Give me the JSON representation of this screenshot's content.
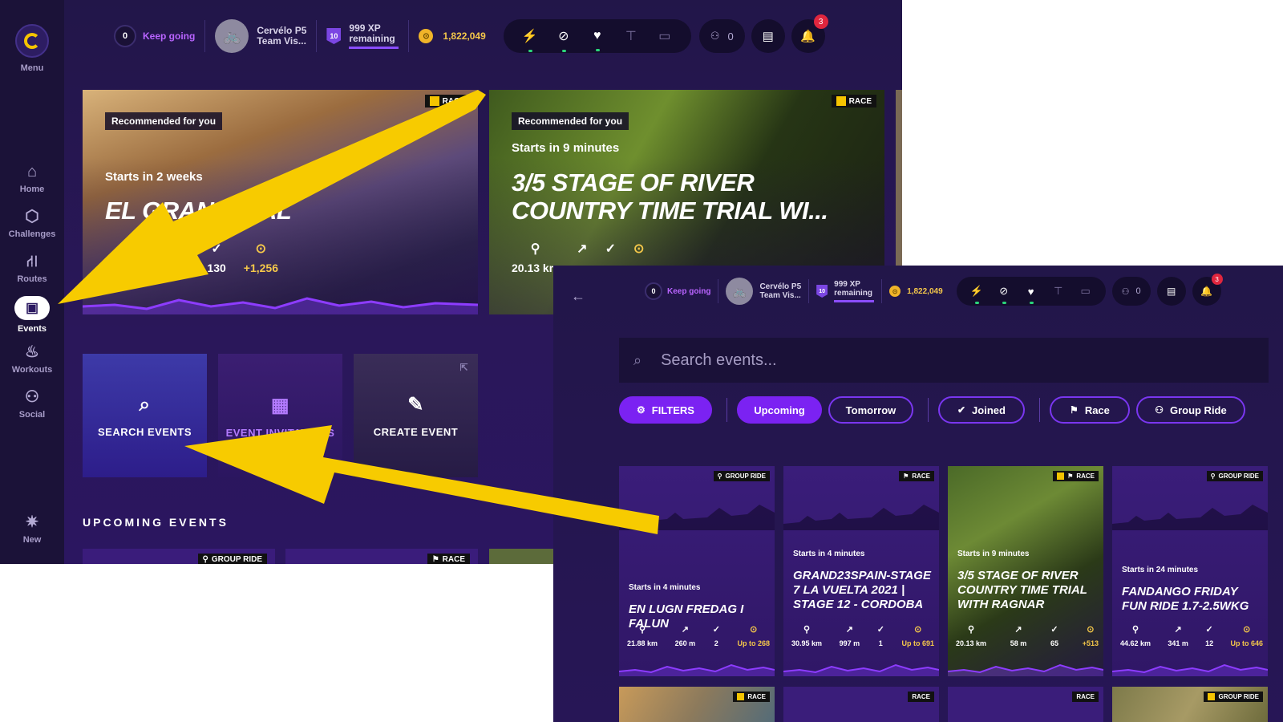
{
  "screen1": {
    "sidebar": {
      "menu_label": "Menu",
      "items": [
        {
          "label": "Home",
          "icon": "home-icon",
          "glyph": "⌂"
        },
        {
          "label": "Challenges",
          "icon": "hexagon-icon",
          "glyph": "⬡"
        },
        {
          "label": "Routes",
          "icon": "road-icon",
          "glyph": "⛙"
        },
        {
          "label": "Events",
          "icon": "calendar-icon",
          "glyph": "▣"
        },
        {
          "label": "Workouts",
          "icon": "flame-icon",
          "glyph": "♨"
        },
        {
          "label": "Social",
          "icon": "people-icon",
          "glyph": "⚇"
        }
      ],
      "new_label": "New"
    },
    "topbar": {
      "streak_count": "0",
      "streak_label": "Keep going",
      "bike_name_line1": "Cervélo P5",
      "bike_name_line2": "Team Vis...",
      "level": "10",
      "xp_line1": "999 XP",
      "xp_line2": "remaining",
      "coins": "1,822,049",
      "friends_count": "0",
      "notification_count": "3"
    },
    "hero_cards": [
      {
        "recommended": "Recommended for you",
        "tag": "RACE",
        "starts": "Starts in 2 weeks",
        "title_line1": "EL GRAN FINAL",
        "stat_elev": "m",
        "stat_riders": "130",
        "stat_xp": "+1,256"
      },
      {
        "recommended": "Recommended for you",
        "tag": "RACE",
        "starts": "Starts in 9 minutes",
        "title_line1": "3/5 STAGE OF RIVER",
        "title_line2": "COUNTRY TIME TRIAL WI...",
        "stat_distance": "20.13 km"
      }
    ],
    "actions": [
      {
        "label": "SEARCH EVENTS",
        "icon": "search-icon"
      },
      {
        "label": "EVENT INVITATIONS",
        "icon": "calendar-icon"
      },
      {
        "label": "CREATE EVENT",
        "icon": "pencil-icon"
      }
    ],
    "upcoming_title": "UPCOMING EVENTS",
    "upcoming_tags": [
      "GROUP RIDE",
      "RACE"
    ]
  },
  "screen2": {
    "topbar": {
      "streak_count": "0",
      "streak_label": "Keep going",
      "bike_name_line1": "Cervélo P5",
      "bike_name_line2": "Team Vis...",
      "level": "10",
      "xp_line1": "999 XP",
      "xp_line2": "remaining",
      "coins": "1,822,049",
      "friends_count": "0",
      "notification_count": "3"
    },
    "search_placeholder": "Search events...",
    "filters": {
      "filters_label": "FILTERS",
      "upcoming": "Upcoming",
      "tomorrow": "Tomorrow",
      "joined": "Joined",
      "race": "Race",
      "group_ride": "Group Ride"
    },
    "events": [
      {
        "tag": "GROUP RIDE",
        "starts": "Starts in 4 minutes",
        "title": "EN LUGN FREDAG I FALUN",
        "distance": "21.88 km",
        "elevation": "260 m",
        "riders": "2",
        "reward": "Up to 268"
      },
      {
        "tag": "RACE",
        "starts": "Starts in 4 minutes",
        "title": "GRAND23SPAIN-STAGE 7 LA VUELTA 2021 | STAGE 12 - CORDOBA",
        "distance": "30.95 km",
        "elevation": "997 m",
        "riders": "1",
        "reward": "Up to 691"
      },
      {
        "tag": "RACE",
        "starts": "Starts in 9 minutes",
        "title": "3/5 STAGE OF RIVER COUNTRY TIME TRIAL WITH RAGNAR",
        "distance": "20.13 km",
        "elevation": "58 m",
        "riders": "65",
        "reward": "+513"
      },
      {
        "tag": "GROUP RIDE",
        "starts": "Starts in 24 minutes",
        "title": "FANDANGO FRIDAY FUN RIDE 1.7-2.5WKG",
        "distance": "44.62 km",
        "elevation": "341 m",
        "riders": "12",
        "reward": "Up to 646"
      }
    ],
    "next_row_tags": [
      "RACE",
      "RACE",
      "RACE",
      "GROUP RIDE"
    ]
  },
  "colors": {
    "accent_purple": "#7b22f2",
    "arrow_yellow": "#f7cb00",
    "gold": "#f5c84a"
  }
}
